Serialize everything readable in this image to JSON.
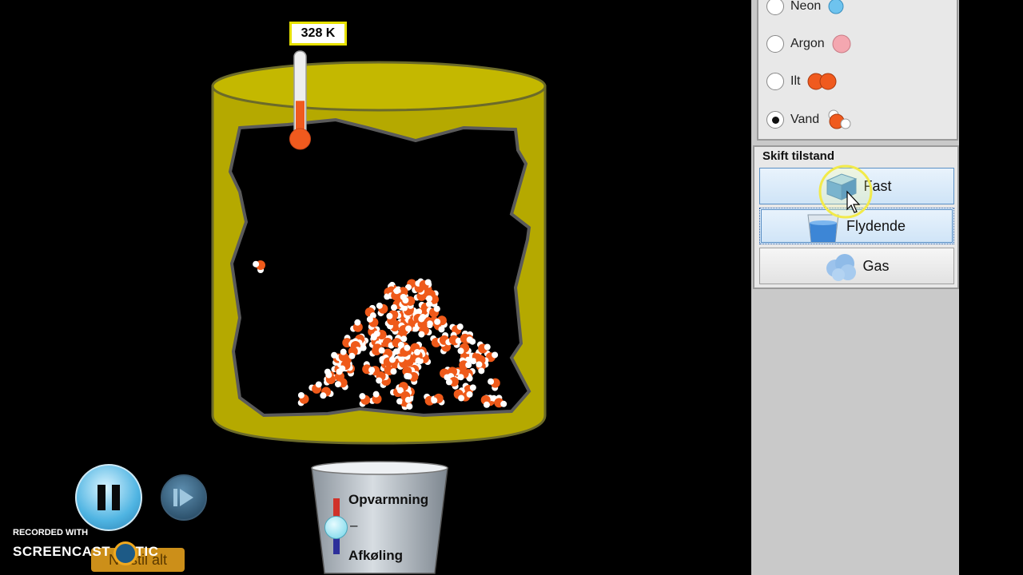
{
  "thermometer": {
    "temperature_label": "328 K",
    "fill_level": 0.45
  },
  "atom_selector": {
    "options": [
      {
        "label": "Neon",
        "selected": false,
        "color": "#6ec3ee"
      },
      {
        "label": "Argon",
        "selected": false,
        "color": "#f4a7b0"
      },
      {
        "label": "Ilt",
        "selected": false,
        "color": "#f05a1e"
      },
      {
        "label": "Vand",
        "selected": true,
        "color": "#f05a1e"
      }
    ]
  },
  "state_panel": {
    "title": "Skift tilstand",
    "buttons": [
      {
        "label": "Fast",
        "icon": "ice-cube-icon"
      },
      {
        "label": "Flydende",
        "icon": "liquid-cup-icon"
      },
      {
        "label": "Gas",
        "icon": "gas-cloud-icon"
      }
    ]
  },
  "heat_control": {
    "heat_label": "Opvarmning",
    "middle_label": "–",
    "cool_label": "Afkøling",
    "level": 0.5
  },
  "playback": {
    "pause_icon": "pause-icon",
    "step_icon": "step-forward-icon"
  },
  "reset": {
    "label": "Nulstil alt"
  },
  "watermark": {
    "line1": "RECORDED WITH",
    "line2": "SCREENCAST   MATIC"
  },
  "colors": {
    "container": "#b5a900",
    "oxygen": "#ef5a1a",
    "hydrogen": "#ffffff",
    "panel": "#c9c9c9"
  }
}
